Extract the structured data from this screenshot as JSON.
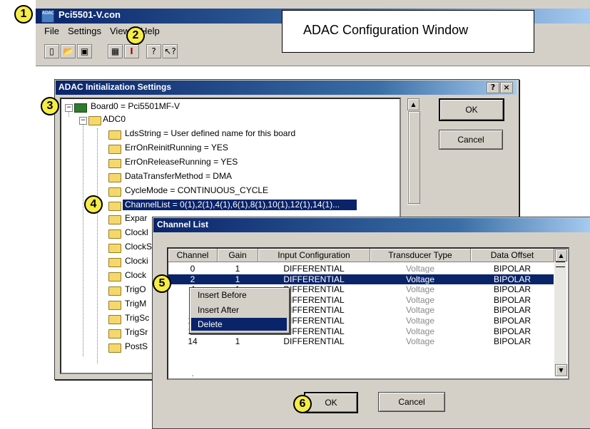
{
  "app": {
    "window_title": "Pci5501-V.con",
    "icon_text": "ADAC",
    "menu": [
      "File",
      "Settings",
      "View",
      "Help"
    ],
    "toolbar_icons": [
      "new-icon",
      "open-icon",
      "save-icon",
      "board-icon",
      "channel-icon",
      "help-icon",
      "context-help-icon"
    ]
  },
  "annotation": {
    "note": "ADAC Configuration Window",
    "callouts": [
      "1",
      "2",
      "3",
      "4",
      "5",
      "6"
    ]
  },
  "init_dialog": {
    "title": "ADAC Initialization Settings",
    "help_btn": "?",
    "close_btn": "×",
    "ok_label": "OK",
    "cancel_label": "Cancel",
    "tree": {
      "root": "Board0 = Pci5501MF-V",
      "adc": "ADC0",
      "items": [
        "LdsString = User defined name for this board",
        "ErrOnReinitRunning = YES",
        "ErrOnReleaseRunning = YES",
        "DataTransferMethod = DMA",
        "CycleMode = CONTINUOUS_CYCLE",
        "ChannelList = 0(1),2(1),4(1),6(1),8(1),10(1),12(1),14(1)...",
        "Expar",
        "Clockl",
        "ClockS",
        "Clocki",
        "Clock",
        "TrigO",
        "TrigM",
        "TrigSc",
        "TrigSr",
        "PostS"
      ]
    }
  },
  "channel_dialog": {
    "title": "Channel List",
    "columns": [
      "Channel",
      "Gain",
      "Input Configuration",
      "Transducer Type",
      "Data Offset"
    ],
    "rows": [
      [
        "0",
        "1",
        "DIFFERENTIAL",
        "Voltage",
        "BIPOLAR"
      ],
      [
        "2",
        "1",
        "DIFFERENTIAL",
        "Voltage",
        "BIPOLAR"
      ],
      [
        "4",
        "1",
        "DIFFERENTIAL",
        "Voltage",
        "BIPOLAR"
      ],
      [
        "6",
        "1",
        "DIFFERENTIAL",
        "Voltage",
        "BIPOLAR"
      ],
      [
        "8",
        "1",
        "DIFFERENTIAL",
        "Voltage",
        "BIPOLAR"
      ],
      [
        "10",
        "1",
        "DIFFERENTIAL",
        "Voltage",
        "BIPOLAR"
      ],
      [
        "12",
        "1",
        "DIFFERENTIAL",
        "Voltage",
        "BIPOLAR"
      ],
      [
        "14",
        "1",
        "DIFFERENTIAL",
        "Voltage",
        "BIPOLAR"
      ]
    ],
    "selected_row": 1,
    "ok_label": "OK",
    "cancel_label": "Cancel"
  },
  "context_menu": {
    "items": [
      "Insert Before",
      "Insert After",
      "Delete"
    ],
    "highlighted": 2
  },
  "colors": {
    "title_bar": "#0a246a",
    "selection": "#0a246a",
    "callout": "#f6ec46",
    "dialog_face": "#d4d0c8"
  }
}
